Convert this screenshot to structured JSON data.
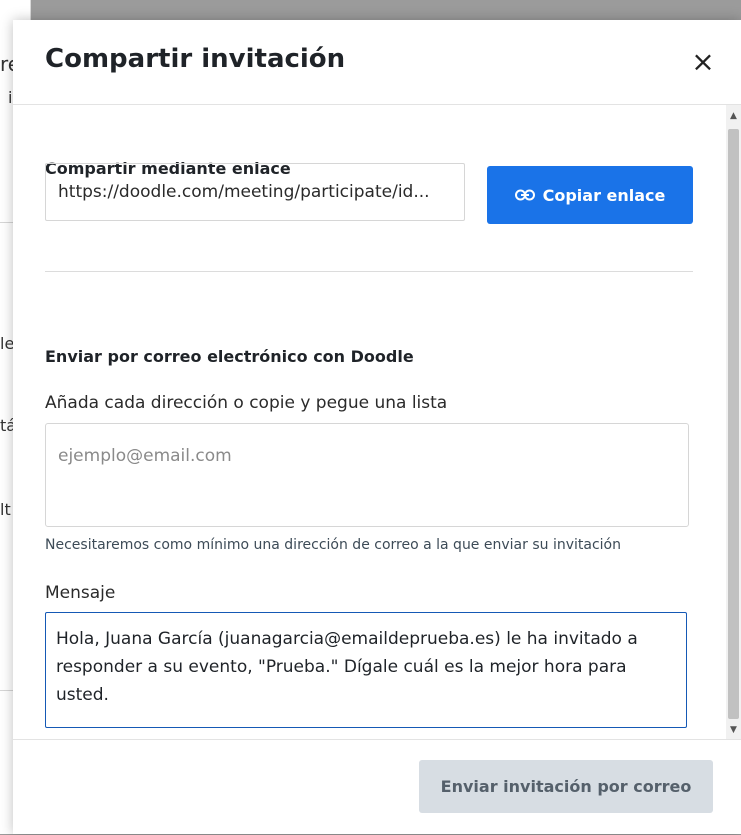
{
  "background": {
    "fragments": [
      "re",
      "i",
      "le",
      "tá",
      "lt"
    ]
  },
  "modal": {
    "title": "Compartir invitación",
    "close_icon": "close-icon",
    "link_section": {
      "title": "Compartir mediante enlace",
      "link_value": "https://doodle.com/meeting/participate/id...",
      "copy_button_label": "Copiar enlace",
      "copy_icon": "link-icon"
    },
    "email_section": {
      "title": "Enviar por correo electrónico con Doodle",
      "address_label": "Añada cada dirección o copie y pegue una lista",
      "address_placeholder": "ejemplo@email.com",
      "hint": "Necesitaremos como mínimo una dirección de correo a la que enviar su invitación",
      "message_label": "Mensaje",
      "message_value": "Hola, Juana García (juanagarcia@emaildeprueba.es) le ha invitado a responder a su evento, \"Prueba.\" Dígale cuál es la mejor hora para usted."
    },
    "footer": {
      "send_button_label": "Enviar invitación por correo"
    }
  },
  "colors": {
    "primary_button": "#1a73e8",
    "disabled_button": "#d7dde3",
    "focus_border": "#1559b5"
  }
}
